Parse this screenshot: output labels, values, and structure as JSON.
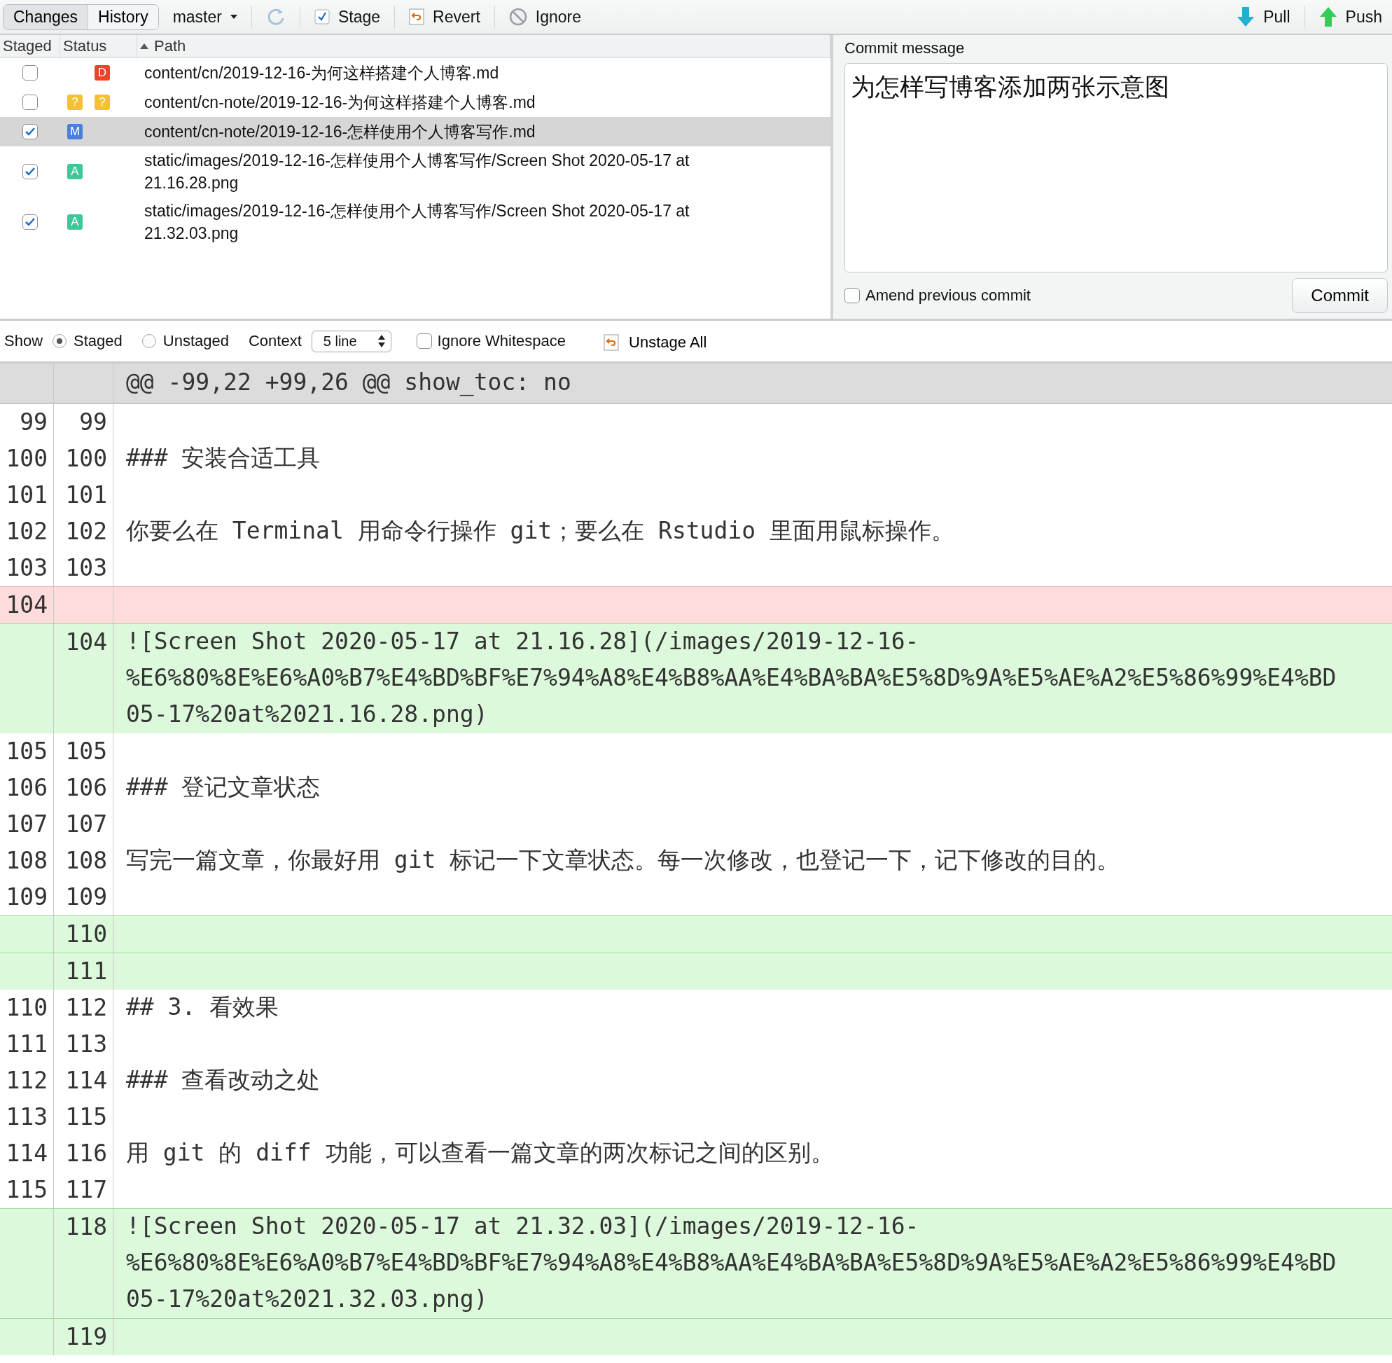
{
  "toolbar": {
    "views": [
      {
        "label": "Changes",
        "selected": true
      },
      {
        "label": "History",
        "selected": false
      }
    ],
    "branch": "master",
    "actions": [
      {
        "kind": "refresh"
      },
      {
        "kind": "stage",
        "label": "Stage"
      },
      {
        "kind": "revert",
        "label": "Revert"
      },
      {
        "kind": "ignore",
        "label": "Ignore"
      }
    ],
    "remote": [
      {
        "kind": "pull",
        "label": "Pull"
      },
      {
        "kind": "push",
        "label": "Push"
      }
    ]
  },
  "files": {
    "columns": [
      "Staged",
      "Status",
      "Path"
    ],
    "rows": [
      {
        "checked": false,
        "selected": false,
        "status": {
          "unstaged": {
            "letter": "D",
            "color": "#e8452c"
          }
        },
        "path": [
          "content/cn/2019-12-16-为何这样搭建个人博客.md"
        ]
      },
      {
        "checked": false,
        "selected": false,
        "status": {
          "staged": {
            "letter": "?",
            "color": "#f2c230"
          },
          "unstaged": {
            "letter": "?",
            "color": "#f2c230"
          }
        },
        "path": [
          "content/cn-note/2019-12-16-为何这样搭建个人博客.md"
        ]
      },
      {
        "checked": true,
        "selected": true,
        "status": {
          "staged": {
            "letter": "M",
            "color": "#4a7fdc"
          }
        },
        "path": [
          "content/cn-note/2019-12-16-怎样使用个人博客写作.md"
        ]
      },
      {
        "checked": true,
        "selected": false,
        "status": {
          "staged": {
            "letter": "A",
            "color": "#3fc79a"
          }
        },
        "path": [
          "static/images/2019-12-16-怎样使用个人博客写作/Screen Shot 2020-05-17 at",
          "21.16.28.png"
        ]
      },
      {
        "checked": true,
        "selected": false,
        "status": {
          "staged": {
            "letter": "A",
            "color": "#3fc79a"
          }
        },
        "path": [
          "static/images/2019-12-16-怎样使用个人博客写作/Screen Shot 2020-05-17 at",
          "21.32.03.png"
        ]
      }
    ]
  },
  "commit": {
    "label": "Commit message",
    "message": "为怎样写博客添加两张示意图",
    "amend": {
      "label": "Amend previous commit",
      "checked": false
    },
    "button": "Commit"
  },
  "options": {
    "show_label": "Show",
    "show": [
      {
        "label": "Staged",
        "selected": true
      },
      {
        "label": "Unstaged",
        "selected": false
      }
    ],
    "context_label": "Context",
    "context": "5 line",
    "ignore_whitespace": {
      "label": "Ignore Whitespace",
      "checked": false
    },
    "unstage_all": "Unstage All"
  },
  "diff": {
    "hunk": "@@ -99,22 +99,26 @@ show_toc: no",
    "lines": [
      {
        "kind": "context",
        "old": "99",
        "new": "99"
      },
      {
        "kind": "context",
        "old": "100",
        "new": "100",
        "text": [
          "### 安装合适工具"
        ]
      },
      {
        "kind": "context",
        "old": "101",
        "new": "101"
      },
      {
        "kind": "context",
        "old": "102",
        "new": "102",
        "text": [
          "你要么在 Terminal 用命令行操作 git；要么在 Rstudio 里面用鼠标操作。"
        ]
      },
      {
        "kind": "context",
        "old": "103",
        "new": "103"
      },
      {
        "kind": "removed",
        "old": "104"
      },
      {
        "kind": "added",
        "new": "104",
        "text": [
          "![Screen Shot 2020-05-17 at 21.16.28](/images/2019-12-16-",
          "%E6%80%8E%E6%A0%B7%E4%BD%BF%E7%94%A8%E4%B8%AA%E4%BA%BA%E5%8D%9A%E5%AE%A2%E5%86%99%E4%BD",
          "05-17%20at%2021.16.28.png)"
        ]
      },
      {
        "kind": "context",
        "old": "105",
        "new": "105"
      },
      {
        "kind": "context",
        "old": "106",
        "new": "106",
        "text": [
          "### 登记文章状态"
        ]
      },
      {
        "kind": "context",
        "old": "107",
        "new": "107"
      },
      {
        "kind": "context",
        "old": "108",
        "new": "108",
        "text": [
          "写完一篇文章，你最好用 git 标记一下文章状态。每一次修改，也登记一下，记下修改的目的。"
        ]
      },
      {
        "kind": "context",
        "old": "109",
        "new": "109"
      },
      {
        "kind": "added",
        "new": "110"
      },
      {
        "kind": "added",
        "new": "111"
      },
      {
        "kind": "context",
        "old": "110",
        "new": "112",
        "text": [
          "## 3. 看效果"
        ]
      },
      {
        "kind": "context",
        "old": "111",
        "new": "113"
      },
      {
        "kind": "context",
        "old": "112",
        "new": "114",
        "text": [
          "### 查看改动之处"
        ]
      },
      {
        "kind": "context",
        "old": "113",
        "new": "115"
      },
      {
        "kind": "context",
        "old": "114",
        "new": "116",
        "text": [
          "用 git 的 diff 功能，可以查看一篇文章的两次标记之间的区别。"
        ]
      },
      {
        "kind": "context",
        "old": "115",
        "new": "117"
      },
      {
        "kind": "added",
        "new": "118",
        "text": [
          "![Screen Shot 2020-05-17 at 21.32.03](/images/2019-12-16-",
          "%E6%80%8E%E6%A0%B7%E4%BD%BF%E7%94%A8%E4%B8%AA%E4%BA%BA%E5%8D%9A%E5%AE%A2%E5%86%99%E4%BD",
          "05-17%20at%2021.32.03.png)"
        ]
      },
      {
        "kind": "added",
        "new": "119"
      }
    ]
  }
}
